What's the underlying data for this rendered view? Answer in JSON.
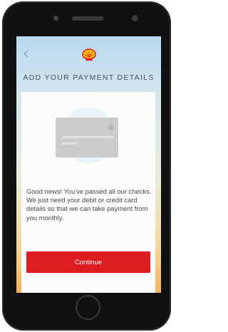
{
  "header": {
    "back_icon": "chevron-left-icon",
    "logo": "shell-logo",
    "title": "ADD YOUR PAYMENT DETAILS"
  },
  "content": {
    "illustration": "credit-card-icon",
    "message": "Good news! You've passed all our checks. We just need your debit or credit card details so that we can take payment from you monthly.",
    "continue_label": "Continue"
  },
  "colors": {
    "brand_red": "#dd1d21",
    "brand_yellow": "#fbce07"
  }
}
